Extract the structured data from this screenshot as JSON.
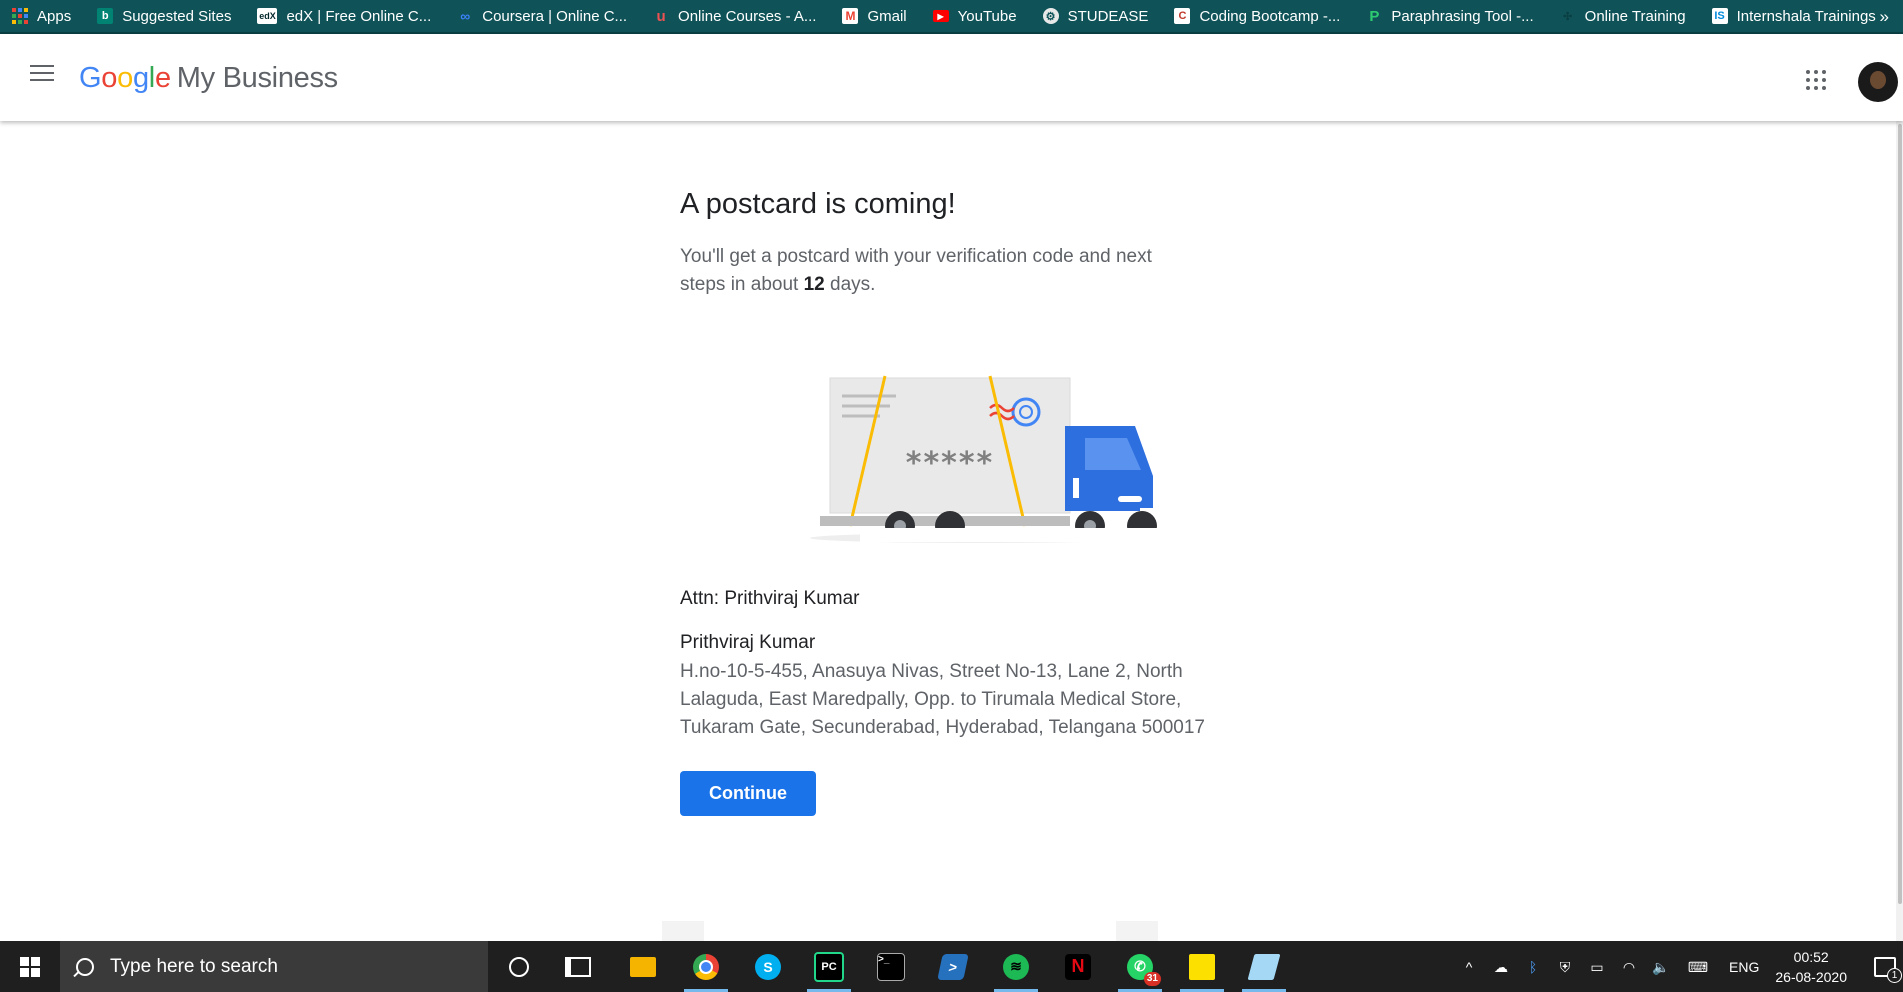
{
  "bookmarks": {
    "items": [
      {
        "label": "Apps",
        "icon": "apps-grid-icon"
      },
      {
        "label": "Suggested Sites",
        "icon": "bing-icon"
      },
      {
        "label": "edX | Free Online C...",
        "icon": "edx-icon"
      },
      {
        "label": "Coursera | Online C...",
        "icon": "coursera-icon"
      },
      {
        "label": "Online Courses - A...",
        "icon": "udemy-icon"
      },
      {
        "label": "Gmail",
        "icon": "gmail-icon"
      },
      {
        "label": "YouTube",
        "icon": "youtube-icon"
      },
      {
        "label": "STUDEASE",
        "icon": "studease-icon"
      },
      {
        "label": "Coding Bootcamp -...",
        "icon": "bootcamp-icon"
      },
      {
        "label": "Paraphrasing Tool -...",
        "icon": "paraphrasing-icon"
      },
      {
        "label": "Online Training",
        "icon": "training-icon"
      },
      {
        "label": "Internshala Trainings",
        "icon": "internshala-icon"
      }
    ],
    "more": "»"
  },
  "header": {
    "logo_google": [
      "G",
      "o",
      "o",
      "g",
      "l",
      "e"
    ],
    "product": "My Business"
  },
  "main": {
    "title": "A postcard is coming!",
    "desc_before": "You'll get a postcard with your verification code and next steps in about ",
    "days": "12",
    "desc_after": " days.",
    "code_mask": "*****",
    "attn": "Attn: Prithviraj Kumar",
    "name": "Prithviraj Kumar",
    "address": "H.no-10-5-455, Anasuya Nivas, Street No-13, Lane 2, North Lalaguda, East Maredpally, Opp. to Tirumala Medical Store, Tukaram Gate, Secunderabad, Hyderabad, Telangana 500017",
    "continue_label": "Continue"
  },
  "taskbar": {
    "search_placeholder": "Type here to search",
    "whatsapp_badge": "31",
    "language": "ENG",
    "time": "00:52",
    "date": "26-08-2020",
    "notification_count": "1"
  }
}
